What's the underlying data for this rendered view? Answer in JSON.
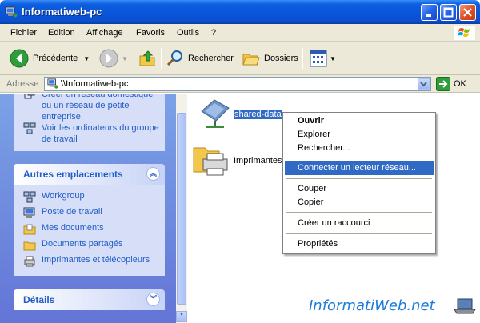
{
  "window": {
    "title": "Informatiweb-pc"
  },
  "menu": [
    "Fichier",
    "Edition",
    "Affichage",
    "Favoris",
    "Outils",
    "?"
  ],
  "toolbar": {
    "back": "Précédente",
    "search": "Rechercher",
    "folders": "Dossiers"
  },
  "address": {
    "label": "Adresse",
    "value": "\\\\Informatiweb-pc",
    "go": "OK"
  },
  "tasks": {
    "item1": "Créer un réseau domestique ou un réseau de petite entreprise",
    "item2": "Voir les ordinateurs du groupe de travail"
  },
  "other_places": {
    "title": "Autres emplacements",
    "items": [
      "Workgroup",
      "Poste de travail",
      "Mes documents",
      "Documents partagés",
      "Imprimantes et télécopieurs"
    ]
  },
  "details": {
    "title": "Détails"
  },
  "files": [
    {
      "name": "shared-data"
    },
    {
      "name": "Imprimantes"
    }
  ],
  "context_menu": {
    "items": [
      "Ouvrir",
      "Explorer",
      "Rechercher...",
      "Connecter un lecteur réseau...",
      "Couper",
      "Copier",
      "Créer un raccourci",
      "Propriétés"
    ]
  },
  "watermark": "InformatiWeb.net",
  "colors": {
    "title_bar": "#0a54d8",
    "link": "#215dc6",
    "selection": "#316ac5"
  }
}
